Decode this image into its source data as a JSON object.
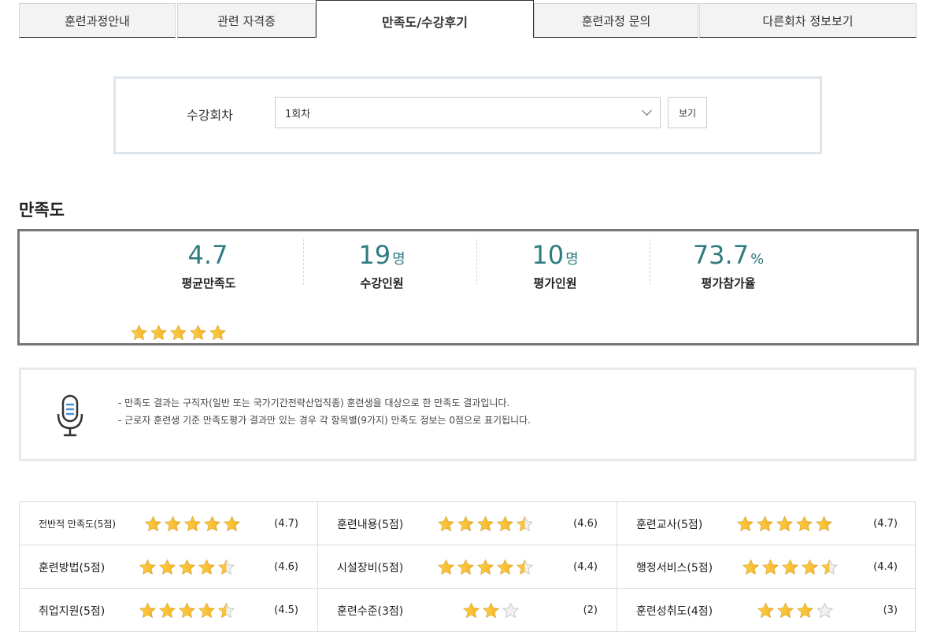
{
  "tabs": [
    {
      "label": "훈련과정안내",
      "active": false
    },
    {
      "label": "관련 자격증",
      "active": false
    },
    {
      "label": "만족도/수강후기",
      "active": true
    },
    {
      "label": "훈련과정 문의",
      "active": false
    },
    {
      "label": "다른회차 정보보기",
      "active": false
    }
  ],
  "session": {
    "label": "수강회차",
    "selected": "1회차",
    "button": "보기"
  },
  "section_title": "만족도",
  "summary": {
    "stats": [
      {
        "value": "4.7",
        "unit": "",
        "label": "평균만족도"
      },
      {
        "value": "19",
        "unit": "명",
        "label": "수강인원"
      },
      {
        "value": "10",
        "unit": "명",
        "label": "평가인원"
      },
      {
        "value": "73.7",
        "unit": "%",
        "label": "평가참가율"
      }
    ],
    "rating": 4.7,
    "max_stars": 5
  },
  "notice": {
    "icon": "microphone-icon",
    "lines": [
      "- 만족도 결과는 구직자(일반 또는 국가기간전략산업직종) 훈련생을 대상으로 한 만족도 결과입니다.",
      "- 근로자 훈련생 기준 만족도평가 결과만 있는 경우 각 항목별(9가지) 만족도 정보는 0점으로 표기됩니다."
    ]
  },
  "ratings": [
    {
      "name": "전반적 만족도(5점)",
      "rating": 4.7,
      "max": 5,
      "score": "(4.7)"
    },
    {
      "name": "훈련내용(5점)",
      "rating": 4.6,
      "max": 5,
      "score": "(4.6)"
    },
    {
      "name": "훈련교사(5점)",
      "rating": 4.7,
      "max": 5,
      "score": "(4.7)"
    },
    {
      "name": "훈련방법(5점)",
      "rating": 4.6,
      "max": 5,
      "score": "(4.6)"
    },
    {
      "name": "시설장비(5점)",
      "rating": 4.4,
      "max": 5,
      "score": "(4.4)"
    },
    {
      "name": "행정서비스(5점)",
      "rating": 4.4,
      "max": 5,
      "score": "(4.4)"
    },
    {
      "name": "취업지원(5점)",
      "rating": 4.5,
      "max": 5,
      "score": "(4.5)"
    },
    {
      "name": "훈련수준(3점)",
      "rating": 2,
      "max": 3,
      "score": "(2)"
    },
    {
      "name": "훈련성취도(4점)",
      "rating": 3,
      "max": 4,
      "score": "(3)"
    }
  ],
  "colors": {
    "accent": "#2e7c82",
    "star_fill": "#f5b324",
    "star_empty": "#c8c8c8"
  }
}
